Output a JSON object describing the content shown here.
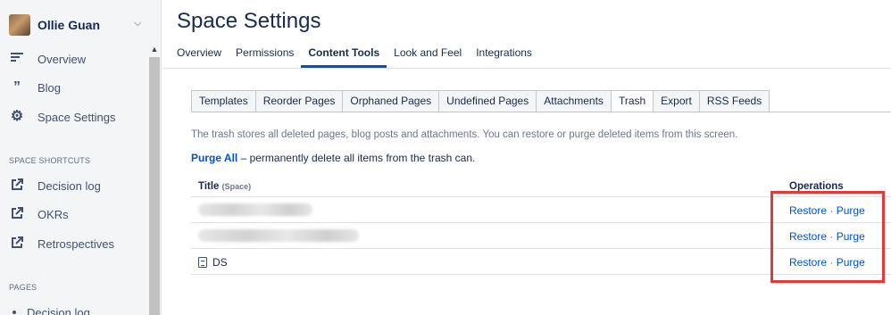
{
  "sidebar": {
    "user_name": "Ollie Guan",
    "nav": [
      {
        "label": "Overview",
        "icon": "lines-icon"
      },
      {
        "label": "Blog",
        "icon": "quote-icon"
      },
      {
        "label": "Space Settings",
        "icon": "gear-icon"
      }
    ],
    "shortcuts_heading": "SPACE SHORTCUTS",
    "shortcuts": [
      {
        "label": "Decision log",
        "icon": "external-link-icon"
      },
      {
        "label": "OKRs",
        "icon": "external-link-icon"
      },
      {
        "label": "Retrospectives",
        "icon": "external-link-icon"
      }
    ],
    "pages_heading": "PAGES",
    "pages": [
      {
        "label": "Decision log"
      }
    ]
  },
  "main": {
    "title": "Space Settings",
    "top_tabs": [
      "Overview",
      "Permissions",
      "Content Tools",
      "Look and Feel",
      "Integrations"
    ],
    "active_top_tab": "Content Tools",
    "sub_tabs": [
      "Templates",
      "Reorder Pages",
      "Orphaned Pages",
      "Undefined Pages",
      "Attachments",
      "Trash",
      "Export",
      "RSS Feeds"
    ],
    "active_sub_tab": "Trash",
    "description": "The trash stores all deleted pages, blog posts and attachments. You can restore or purge deleted items from this screen.",
    "purge_all_label": "Purge All",
    "purge_all_text": " – permanently delete all items from the trash can.",
    "table": {
      "col_title": "Title",
      "col_title_sub": "(Space)",
      "col_ops": "Operations",
      "rows": [
        {
          "title": "",
          "redacted": true,
          "restore": "Restore",
          "separator": "·",
          "purge": "Purge"
        },
        {
          "title": "",
          "redacted": true,
          "restore": "Restore",
          "separator": "·",
          "purge": "Purge"
        },
        {
          "title": "DS",
          "redacted": false,
          "restore": "Restore",
          "separator": "·",
          "purge": "Purge"
        }
      ]
    }
  },
  "colors": {
    "link": "#0052cc",
    "active_tab_underline": "#0052cc",
    "highlight_box": "#e53935",
    "sidebar_bg": "#f4f5f7"
  }
}
